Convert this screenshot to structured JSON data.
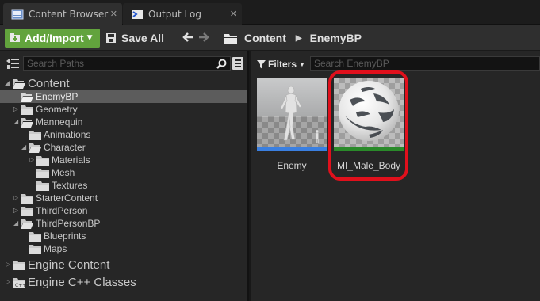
{
  "tabs": [
    {
      "label": "Content Browser",
      "icon": "content-browser-icon",
      "active": true
    },
    {
      "label": "Output Log",
      "icon": "output-log-icon",
      "active": false
    }
  ],
  "toolbar": {
    "add_import_label": "Add/Import",
    "save_all_label": "Save All",
    "breadcrumbs": [
      "Content",
      "EnemyBP"
    ],
    "accent": "#62a33d"
  },
  "sources": {
    "search_placeholder": "Search Paths",
    "tree": [
      {
        "label": "Content",
        "level": 0,
        "expanded": true,
        "big": true
      },
      {
        "label": "EnemyBP",
        "level": 1,
        "selected": true
      },
      {
        "label": "Geometry",
        "level": 1,
        "expandable": true
      },
      {
        "label": "Mannequin",
        "level": 1,
        "expanded": true
      },
      {
        "label": "Animations",
        "level": 2
      },
      {
        "label": "Character",
        "level": 2,
        "expanded": true
      },
      {
        "label": "Materials",
        "level": 3,
        "expandable": true
      },
      {
        "label": "Mesh",
        "level": 3
      },
      {
        "label": "Textures",
        "level": 3
      },
      {
        "label": "StarterContent",
        "level": 1,
        "expandable": true
      },
      {
        "label": "ThirdPerson",
        "level": 1,
        "expandable": true
      },
      {
        "label": "ThirdPersonBP",
        "level": 1,
        "expanded": true
      },
      {
        "label": "Blueprints",
        "level": 2
      },
      {
        "label": "Maps",
        "level": 2
      },
      {
        "label": "Engine Content",
        "level": 0,
        "expandable": true,
        "big": true
      },
      {
        "label": "Engine C++ Classes",
        "level": 0,
        "expandable": true,
        "big": true
      }
    ]
  },
  "assets": {
    "filters_label": "Filters",
    "search_placeholder": "Search EnemyBP",
    "items": [
      {
        "name": "Enemy",
        "type_color": "#3a7fe0"
      },
      {
        "name": "MI_Male_Body",
        "type_color": "#2a8a2a",
        "highlighted": true
      }
    ],
    "highlight_color": "#e0101c"
  }
}
